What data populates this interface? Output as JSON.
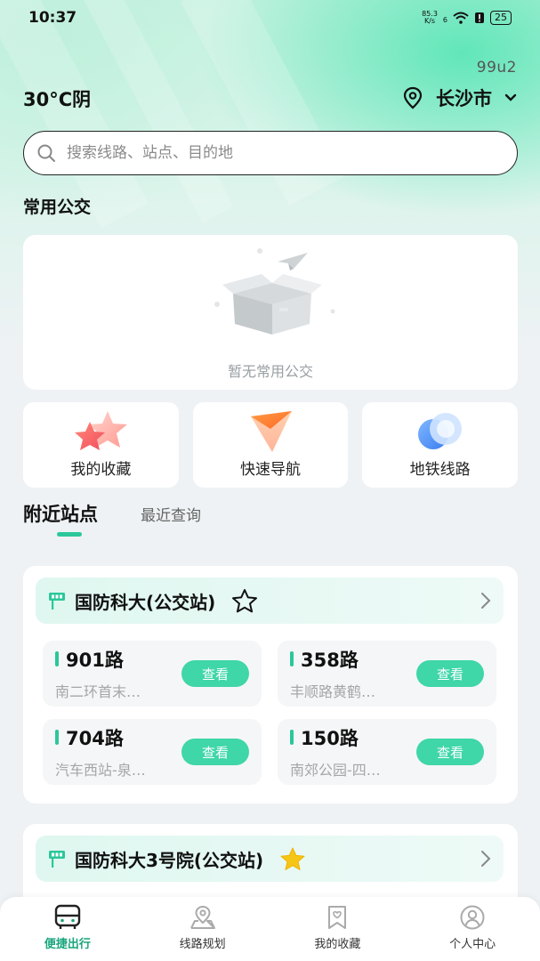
{
  "status_bar": {
    "time": "10:37",
    "net_speed_value": "85.3",
    "net_speed_unit": "K/s",
    "signal": "6",
    "battery": "25"
  },
  "header": {
    "version": "99u2",
    "weather": "30°C阴",
    "city": "长沙市"
  },
  "search": {
    "placeholder": "搜索线路、站点、目的地"
  },
  "common_bus": {
    "title": "常用公交",
    "empty_text": "暂无常用公交"
  },
  "quick_actions": [
    {
      "label": "我的收藏",
      "icon": "stars-icon"
    },
    {
      "label": "快速导航",
      "icon": "navigation-icon"
    },
    {
      "label": "地铁线路",
      "icon": "metro-icon"
    }
  ],
  "tabs": {
    "active": "附近站点",
    "inactive": "最近查询"
  },
  "stops": [
    {
      "name": "国防科大(公交站)",
      "favorited": false,
      "routes": [
        {
          "name": "901路",
          "desc": "南二环首末…",
          "button": "查看"
        },
        {
          "name": "358路",
          "desc": "丰顺路黄鹤…",
          "button": "查看"
        },
        {
          "name": "704路",
          "desc": "汽车西站-泉…",
          "button": "查看"
        },
        {
          "name": "150路",
          "desc": "南郊公园-四…",
          "button": "查看"
        }
      ]
    },
    {
      "name": "国防科大3号院(公交站)",
      "favorited": true,
      "routes": []
    }
  ],
  "bottom_nav": [
    {
      "label": "便捷出行",
      "icon": "bus-icon",
      "active": true
    },
    {
      "label": "线路规划",
      "icon": "route-plan-icon",
      "active": false
    },
    {
      "label": "我的收藏",
      "icon": "bookmark-icon",
      "active": false
    },
    {
      "label": "个人中心",
      "icon": "user-icon",
      "active": false
    }
  ],
  "colors": {
    "accent": "#3fd6a8",
    "accent_dark": "#1aa57c",
    "star_favorited": "#f5c518"
  }
}
